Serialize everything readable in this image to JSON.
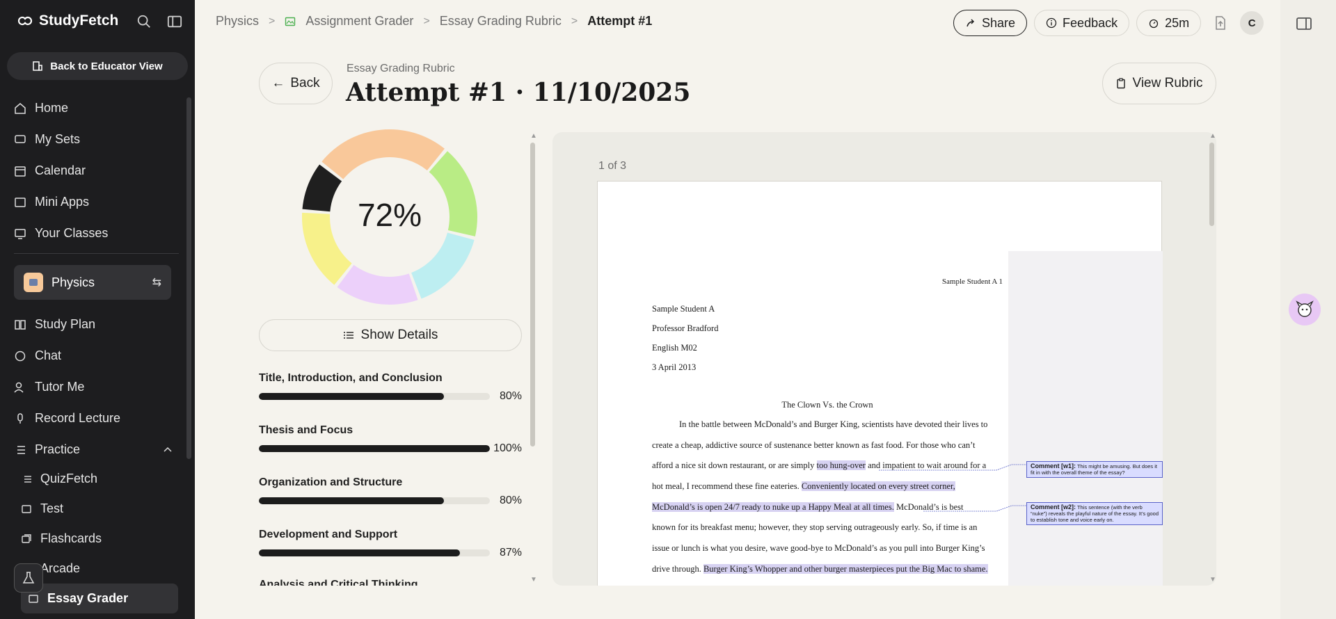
{
  "app": {
    "brand": "StudyFetch",
    "educator_button": "Back to Educator View"
  },
  "nav": {
    "items": [
      "Home",
      "My Sets",
      "Calendar",
      "Mini Apps",
      "Your Classes"
    ],
    "class_name": "Physics",
    "class_items": [
      "Study Plan",
      "Chat",
      "Tutor Me",
      "Record Lecture",
      "Practice"
    ],
    "practice_items": [
      "QuizFetch",
      "Test",
      "Flashcards",
      "Arcade",
      "Essay Grader"
    ]
  },
  "breadcrumb": [
    "Physics",
    "Assignment Grader",
    "Essay Grading Rubric",
    "Attempt #1"
  ],
  "toolbar": {
    "share": "Share",
    "feedback": "Feedback",
    "timer": "25m",
    "avatar_initial": "C"
  },
  "header": {
    "back": "Back",
    "kicker": "Essay Grading Rubric",
    "title": "Attempt #1 · 11/10/2025",
    "view_rubric": "View Rubric"
  },
  "score": {
    "percent_label": "72%",
    "percent": 72,
    "segment_colors": [
      "#f9c89a",
      "#b9ec85",
      "#bdeef1",
      "#ecd0fa",
      "#f7f18a",
      "#1f1f1f"
    ],
    "show_details": "Show Details"
  },
  "criteria": [
    {
      "name": "Title, Introduction, and Conclusion",
      "value_label": "80%",
      "value": 80
    },
    {
      "name": "Thesis and Focus",
      "value_label": "100%",
      "value": 100
    },
    {
      "name": "Organization and Structure",
      "value_label": "80%",
      "value": 80
    },
    {
      "name": "Development and Support",
      "value_label": "87%",
      "value": 87
    },
    {
      "name": "Analysis and Critical Thinking"
    }
  ],
  "document": {
    "page_count": "1 of 3",
    "running_header": "Sample Student A  1",
    "heading_lines": [
      "Sample Student A",
      "Professor Bradford",
      "English M02",
      "3 April 2013"
    ],
    "essay_title": "The Clown Vs. the Crown",
    "p1": "In the battle between McDonald’s and Burger King, scientists have devoted their lives to",
    "p2": "create a cheap, addictive source of sustenance better known as fast food.  For those who can’t",
    "p3a": "afford a nice sit down restaurant, or are simply ",
    "p3hl": "too hung-over",
    "p3b": " and impatient to wait around for a",
    "p4a": "hot meal, I recommend these fine eateries.  ",
    "p4hl": "Conveniently located on every street corner,",
    "p5hl": "McDonald’s is open 24/7 ready to nuke up a Happy Meal at all times.",
    "p5b": "  McDonald’s is best",
    "p6": "known for its breakfast menu; however, they stop serving outrageously early.   So, if time is an",
    "p7": "issue or lunch is what you desire, wave good-bye to McDonald’s as you pull into Burger King’s",
    "p8a": "drive through.  ",
    "p8hl": "Burger King’s Whopper and other burger masterpieces put the Big Mac to shame.",
    "comment1_title": "Comment [w1]:",
    "comment1_body": " This might be amusing.  But does it fit in with the overall theme of the essay?",
    "comment2_title": "Comment [w2]:",
    "comment2_body": " This sentence (with the verb “nuke”) reveals the playful nature of the essay.  It’s good to establish tone and voice early on."
  }
}
